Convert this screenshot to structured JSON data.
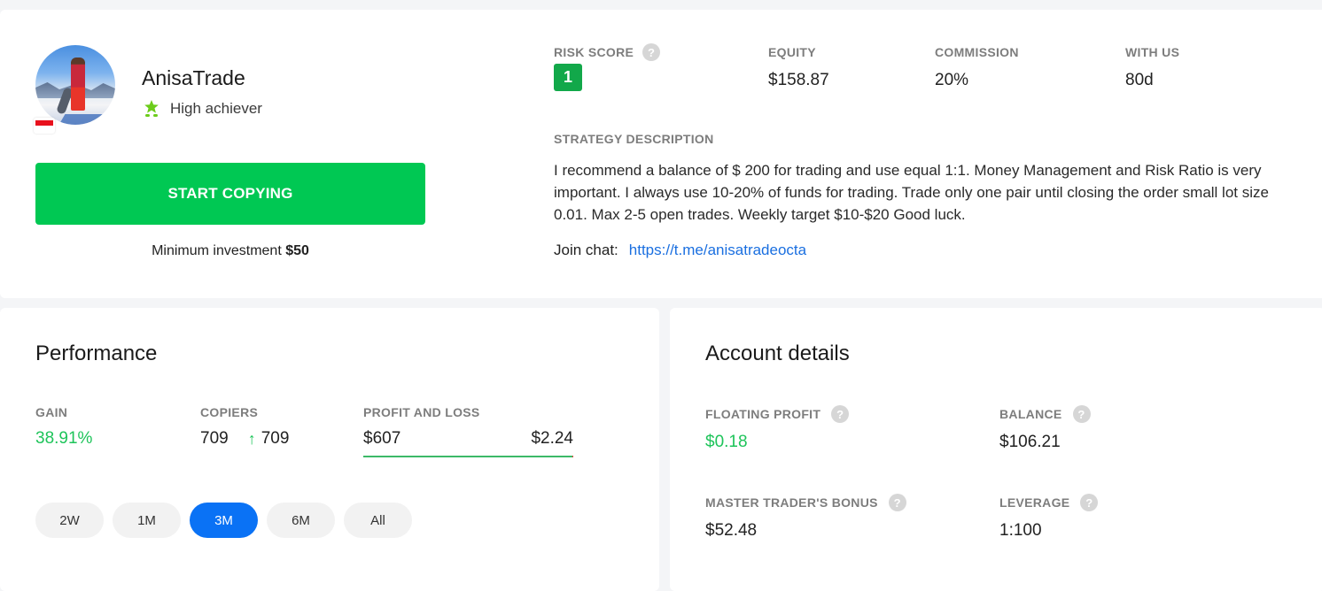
{
  "trader": {
    "name": "AnisaTrade",
    "badge_label": "High achiever",
    "country_flag": "indonesia-flag",
    "start_button_label": "START COPYING",
    "min_investment_label": "Minimum investment",
    "min_investment_value": "$50"
  },
  "stats": {
    "risk_score": {
      "label": "RISK SCORE",
      "value": "1",
      "color": "#12a84a"
    },
    "equity": {
      "label": "EQUITY",
      "value": "$158.87"
    },
    "commission": {
      "label": "COMMISSION",
      "value": "20%"
    },
    "with_us": {
      "label": "WITH US",
      "value": "80d"
    }
  },
  "strategy": {
    "title": "STRATEGY DESCRIPTION",
    "text": "I recommend a balance of $ 200 for trading and use equal 1:1. Money Management and Risk Ratio is very important. I always use 10-20% of funds for trading. Trade only one pair until closing the order small lot size 0.01. Max 2-5 open trades. Weekly target $10-$20 Good luck.",
    "join_chat_label": "Join chat:",
    "join_chat_link": "https://t.me/anisatradeocta"
  },
  "performance": {
    "title": "Performance",
    "gain": {
      "label": "GAIN",
      "value": "38.91%"
    },
    "copiers": {
      "label": "COPIERS",
      "value": "709",
      "delta": "709",
      "delta_icon": "arrow-up-icon"
    },
    "pnl": {
      "label": "PROFIT AND LOSS",
      "profit": "$607",
      "loss": "$2.24",
      "profit_fraction": 0.9963
    },
    "periods": [
      {
        "label": "2W",
        "active": false
      },
      {
        "label": "1M",
        "active": false
      },
      {
        "label": "3M",
        "active": true
      },
      {
        "label": "6M",
        "active": false
      },
      {
        "label": "All",
        "active": false
      }
    ]
  },
  "account": {
    "title": "Account details",
    "floating_profit": {
      "label": "FLOATING PROFIT",
      "value": "$0.18"
    },
    "balance": {
      "label": "BALANCE",
      "value": "$106.21"
    },
    "master_bonus": {
      "label": "MASTER TRADER'S BONUS",
      "value": "$52.48"
    },
    "leverage": {
      "label": "LEVERAGE",
      "value": "1:100"
    }
  },
  "colors": {
    "accent_green": "#00c853",
    "positive": "#1ec45a",
    "active_tab": "#0a72f5",
    "link": "#1a6fe0"
  }
}
